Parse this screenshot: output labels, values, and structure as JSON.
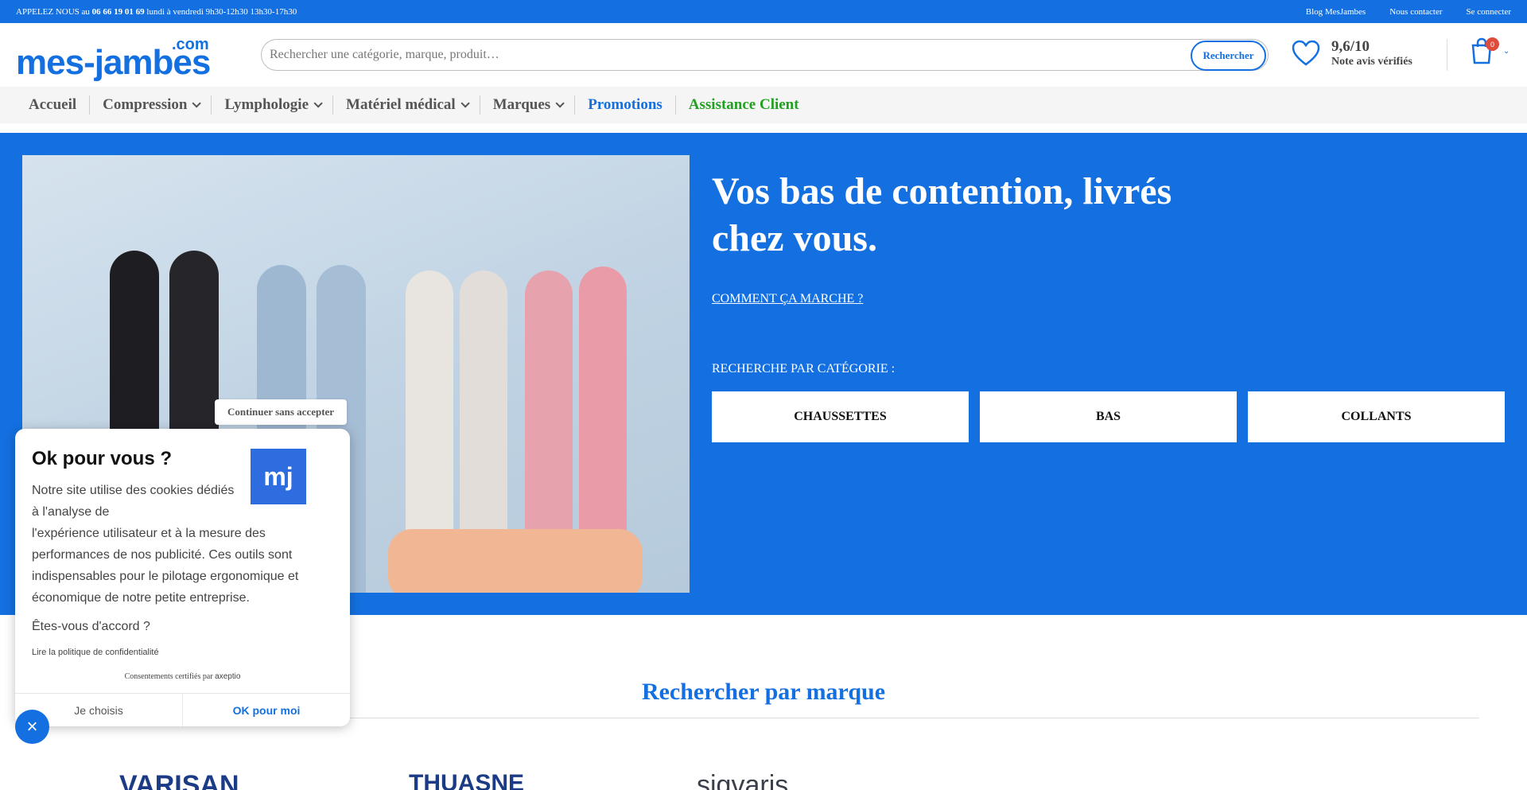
{
  "topbar": {
    "phone_prefix": "APPELEZ NOUS au",
    "phone_number": "06 66 19 01 69",
    "phone_hours": "lundi à vendredi 9h30-12h30 13h30-17h30",
    "links": [
      "Blog MesJambes",
      "Nous contacter",
      "Se connecter"
    ]
  },
  "header": {
    "logo_main": "mes-jambes",
    "logo_suffix": ".com",
    "search_placeholder": "Rechercher une catégorie, marque, produit…",
    "search_button": "Rechercher",
    "rating_score": "9,6/10",
    "rating_label": "Note avis vérifiés",
    "cart_count": "0"
  },
  "nav": {
    "items": [
      {
        "label": "Accueil"
      },
      {
        "label": "Compression"
      },
      {
        "label": "Lymphologie"
      },
      {
        "label": "Matériel médical"
      },
      {
        "label": "Marques"
      },
      {
        "label": "Promotions"
      },
      {
        "label": "Assistance Client"
      }
    ]
  },
  "hero": {
    "title": "Vos bas de contention, livrés chez vous.",
    "how_link": "COMMENT ÇA MARCHE ?",
    "category_title": "RECHERCHE PAR CATÉGORIE :",
    "categories": [
      "CHAUSSETTES",
      "BAS",
      "COLLANTS"
    ]
  },
  "brands": {
    "title": "Rechercher par marque",
    "items": [
      "VARISAN",
      "THUASNE",
      "sigvaris"
    ]
  },
  "cookie": {
    "title": "Ok pour vous ?",
    "logo_text": "mj",
    "text_part1": "Notre site utilise des cookies dédiés à l'analyse de",
    "text_part2": "l'expérience utilisateur et à la mesure des performances de nos publicité. Ces outils sont indispensables pour le pilotage ergonomique et économique de notre petite entreprise.",
    "ask": "Êtes-vous d'accord ?",
    "policy_link": "Lire la politique de confidentialité",
    "certified": "Consentements certifiés par",
    "certified_brand": "axeptio",
    "choose_button": "Je choisis",
    "ok_button": "OK pour moi",
    "skip_button": "Continuer sans accepter"
  },
  "colors": {
    "brand_blue": "#1470e0",
    "assist_green": "#22a022",
    "badge_red": "#e04c3c"
  }
}
